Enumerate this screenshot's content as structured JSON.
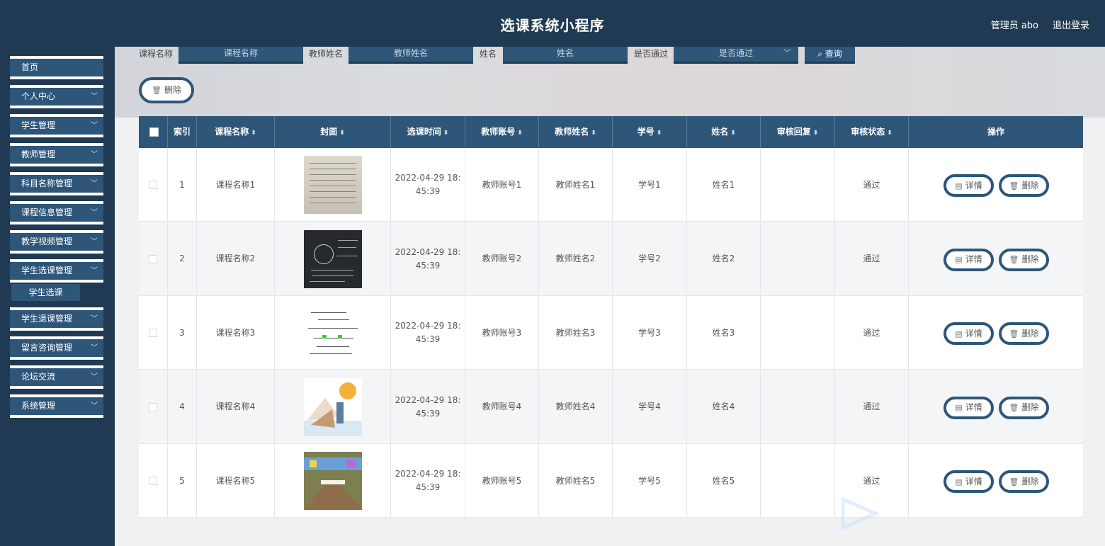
{
  "header": {
    "title": "选课系统小程序",
    "user_label": "管理员 abo",
    "logout_label": "退出登录"
  },
  "sidebar": {
    "items": [
      {
        "label": "首页",
        "has_chevron": false
      },
      {
        "label": "个人中心",
        "has_chevron": true
      },
      {
        "label": "学生管理",
        "has_chevron": true
      },
      {
        "label": "教师管理",
        "has_chevron": true
      },
      {
        "label": "科目名称管理",
        "has_chevron": true
      },
      {
        "label": "课程信息管理",
        "has_chevron": true
      },
      {
        "label": "教学视频管理",
        "has_chevron": true
      },
      {
        "label": "学生选课管理",
        "has_chevron": true
      },
      {
        "label": "学生退课管理",
        "has_chevron": true
      },
      {
        "label": "留言咨询管理",
        "has_chevron": true
      },
      {
        "label": "论坛交流",
        "has_chevron": true
      },
      {
        "label": "系统管理",
        "has_chevron": true
      }
    ],
    "active_sub": "学生选课",
    "chevron": "chevron-down-icon"
  },
  "search": {
    "course_label": "课程名称",
    "course_placeholder": "课程名称",
    "teacher_label": "教师姓名",
    "teacher_placeholder": "教师姓名",
    "name_label": "姓名",
    "name_placeholder": "姓名",
    "pass_label": "是否通过",
    "pass_placeholder": "是否通过",
    "query_label": "查询",
    "query_icon": "search-icon"
  },
  "actions": {
    "delete_label": "删除",
    "delete_icon": "trash-icon"
  },
  "table": {
    "headers": [
      "索引",
      "课程名称",
      "封面",
      "选课时间",
      "教师账号",
      "教师姓名",
      "学号",
      "姓名",
      "审核回复",
      "审核状态",
      "操作"
    ],
    "rows": [
      {
        "index": "1",
        "course": "课程名称1",
        "time": "2022-04-29 18:45:39",
        "time_a": "2022-04-29 18:",
        "time_b": "45:39",
        "teacher_acct": "教师账号1",
        "teacher_name": "教师姓名1",
        "student_no": "学号1",
        "name": "姓名1",
        "reply": "",
        "status": "通过"
      },
      {
        "index": "2",
        "course": "课程名称2",
        "time": "2022-04-29 18:45:39",
        "time_a": "2022-04-29 18:",
        "time_b": "45:39",
        "teacher_acct": "教师账号2",
        "teacher_name": "教师姓名2",
        "student_no": "学号2",
        "name": "姓名2",
        "reply": "",
        "status": "通过"
      },
      {
        "index": "3",
        "course": "课程名称3",
        "time": "2022-04-29 18:45:39",
        "time_a": "2022-04-29 18:",
        "time_b": "45:39",
        "teacher_acct": "教师账号3",
        "teacher_name": "教师姓名3",
        "student_no": "学号3",
        "name": "姓名3",
        "reply": "",
        "status": "通过"
      },
      {
        "index": "4",
        "course": "课程名称4",
        "time": "2022-04-29 18:45:39",
        "time_a": "2022-04-29 18:",
        "time_b": "45:39",
        "teacher_acct": "教师账号4",
        "teacher_name": "教师姓名4",
        "student_no": "学号4",
        "name": "姓名4",
        "reply": "",
        "status": "通过"
      },
      {
        "index": "5",
        "course": "课程名称5",
        "time": "2022-04-29 18:45:39",
        "time_a": "2022-04-29 18:",
        "time_b": "45:39",
        "teacher_acct": "教师账号5",
        "teacher_name": "教师姓名5",
        "student_no": "学号5",
        "name": "姓名5",
        "reply": "",
        "status": "通过"
      }
    ],
    "detail_label": "详情",
    "detail_icon": "document-icon",
    "row_delete_label": "删除",
    "row_delete_icon": "trash-icon"
  },
  "colors": {
    "header_bg": "#1f3a52",
    "accent": "#2e5679"
  }
}
